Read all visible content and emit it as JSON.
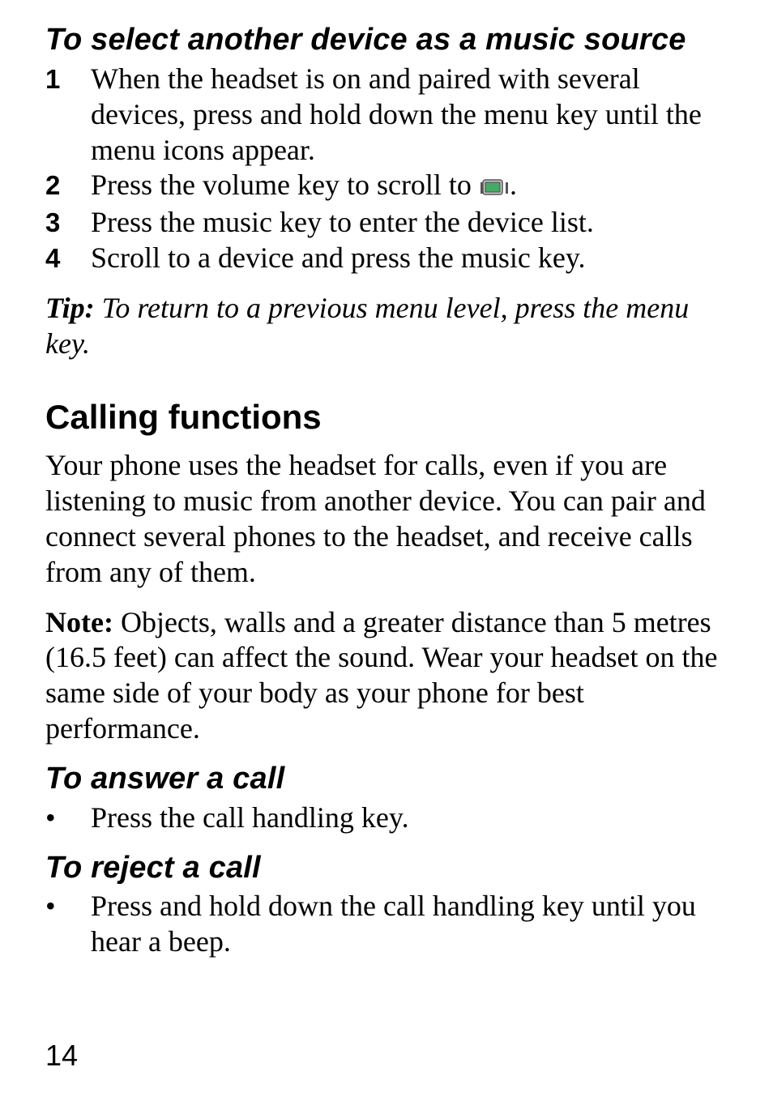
{
  "sections": {
    "select_source": {
      "heading": "To select another device as a music source",
      "steps": [
        "When the headset is on and paired with several devices, press and hold down the menu key until the menu icons appear.",
        "Press the volume key to scroll to ",
        "Press the music key to enter the device list.",
        "Scroll to a device and press the music key."
      ],
      "step2_suffix": "."
    },
    "tip": {
      "label": "Tip:",
      "text": " To return to a previous menu level, press the menu key."
    },
    "calling": {
      "heading": "Calling functions",
      "intro": "Your phone uses the headset for calls, even if you are listening to music from another device. You can pair and connect several phones to the headset, and receive calls from any of them.",
      "note_label": "Note: ",
      "note_text": "Objects, walls and a greater distance than 5 metres (16.5 feet) can affect the sound. Wear your headset on the same side of your body as your phone for best performance."
    },
    "answer": {
      "heading": "To answer a call",
      "bullet": "Press the call handling key."
    },
    "reject": {
      "heading": "To reject a call",
      "bullet": "Press and hold down the call handling key until you hear a beep."
    }
  },
  "page_number": "14",
  "icon_name": "device-list-icon"
}
